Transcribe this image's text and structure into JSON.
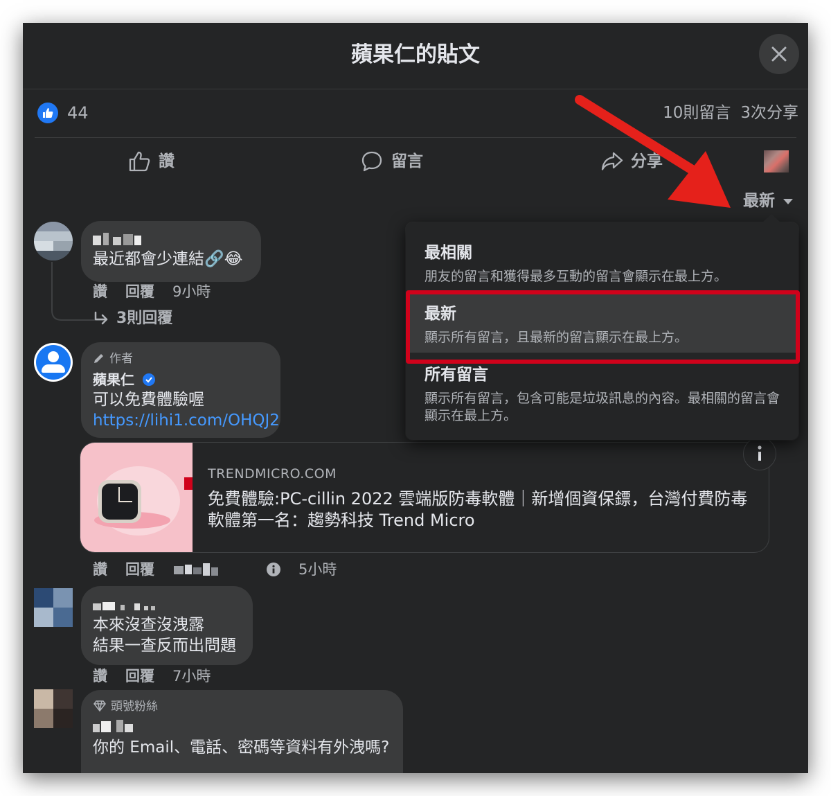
{
  "dialog": {
    "title": "蘋果仁的貼文",
    "close_icon": "close-icon"
  },
  "stats": {
    "reaction_icon": "thumbs-up-icon",
    "reaction_count": "44",
    "comments": "10則留言",
    "shares": "3次分享"
  },
  "actions": {
    "like": "讚",
    "comment": "留言",
    "share": "分享"
  },
  "sort": {
    "current": "最新"
  },
  "sort_menu": [
    {
      "title": "最相關",
      "desc": "朋友的留言和獲得最多互動的留言會顯示在最上方。"
    },
    {
      "title": "最新",
      "desc": "顯示所有留言，且最新的留言顯示在最上方。"
    },
    {
      "title": "所有留言",
      "desc": "顯示所有留言，包含可能是垃圾訊息的內容。最相關的留言會顯示在最上方。"
    }
  ],
  "comments": [
    {
      "text": "最近都會少連結🔗😂",
      "like": "讚",
      "reply": "回覆",
      "time": "9小時",
      "replies": "3則回覆"
    },
    {
      "tag": "作者",
      "name": "蘋果仁",
      "text": "可以免費體驗喔",
      "link": "https://lihi1.com/OHQJ2",
      "like": "讚",
      "reply": "回覆",
      "time": "5小時",
      "card": {
        "domain": "TRENDMICRO.COM",
        "title": "免費體驗:PC-cillin 2022 雲端版防毒軟體｜新增個資保鏢，台灣付費防毒軟體第一名：趨勢科技 Trend Micro"
      }
    },
    {
      "text_line1": "本來沒查沒洩露",
      "text_line2": "結果一查反而出問題",
      "like": "讚",
      "reply": "回覆",
      "time": "7小時"
    },
    {
      "tag": "頭號粉絲",
      "text": "你的 Email、電話、密碼等資料有外洩嗎?"
    }
  ],
  "colors": {
    "background": "#242526",
    "bubble": "#3a3b3c",
    "accent_blue": "#2078f4",
    "link_blue": "#4599ff",
    "annotation_red": "#d0021b"
  }
}
